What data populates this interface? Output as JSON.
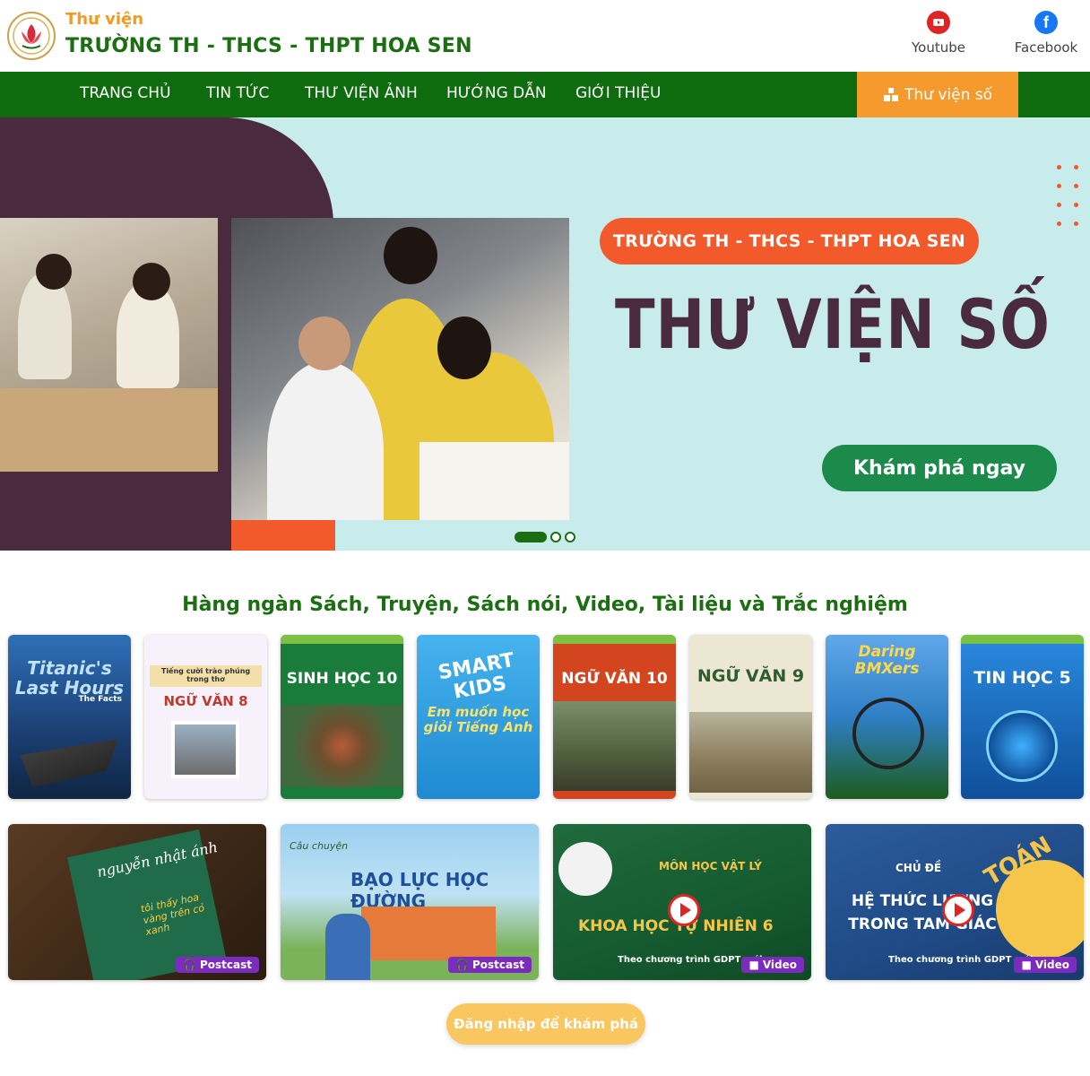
{
  "header": {
    "brand_sub": "Thư viện",
    "brand_title": "TRƯỜNG TH - THCS - THPT HOA SEN",
    "social": [
      {
        "label": "Youtube",
        "icon": "youtube-icon"
      },
      {
        "label": "Facebook",
        "icon": "facebook-icon"
      }
    ]
  },
  "nav": {
    "items": [
      "TRANG CHỦ",
      "TIN TỨC",
      "THƯ VIỆN ẢNH",
      "HƯỚNG DẪN",
      "GIỚI THIỆU"
    ],
    "library_label": "Thư viện số"
  },
  "hero": {
    "school_name": "TRƯỜNG TH - THCS - THPT HOA SEN",
    "title": "THƯ VIỆN SỐ",
    "cta": "Khám phá ngay",
    "slides_total": 3,
    "slide_active": 1
  },
  "section": {
    "title": "Hàng ngàn Sách, Truyện, Sách nói, Video, Tài liệu và Trắc nghiệm"
  },
  "books": [
    {
      "title": "Titanic's Last Hours",
      "sub": "The Facts",
      "bg": "#1e4e87"
    },
    {
      "title": "NGỮ VĂN 8",
      "sub": "Tiếng cười trào phúng trong thơ",
      "bg": "#f4eefa"
    },
    {
      "title": "SINH HỌC 10",
      "sub": "",
      "bg": "#1a7c3a"
    },
    {
      "title": "SMART KIDS",
      "sub": "Em muốn học giỏi Tiếng Anh",
      "bg": "#2ea6e6"
    },
    {
      "title": "NGỮ VĂN 10",
      "sub": "",
      "bg": "#d2451f"
    },
    {
      "title": "NGỮ VĂN 9",
      "sub": "",
      "bg": "#e9e4cf"
    },
    {
      "title": "Daring BMXers",
      "sub": "",
      "bg": "#3f8dd6"
    },
    {
      "title": "TIN HỌC 5",
      "sub": "",
      "bg": "#1e73c8"
    }
  ],
  "media": [
    {
      "title": "nguyễn nhật ánh",
      "sub": "tôi thấy hoa vàng trên cỏ xanh",
      "badge": "Postcast"
    },
    {
      "title": "BẠO LỰC HỌC ĐƯỜNG",
      "sub": "Câu chuyện",
      "badge": "Postcast"
    },
    {
      "title": "KHOA HỌC TỰ NHIÊN 6",
      "sub": "MÔN HỌC VẬT LÝ",
      "note": "Theo chương trình GDPT mới",
      "badge": "Video"
    },
    {
      "title": "HỆ THỨC LƯỢNG TRONG TAM GIÁC",
      "sub": "CHỦ ĐỀ",
      "tag": "TOÁN 10",
      "note": "Theo chương trình GDPT mới",
      "badge": "Video"
    }
  ],
  "login": {
    "label": "Đăng nhập để khám phá"
  }
}
